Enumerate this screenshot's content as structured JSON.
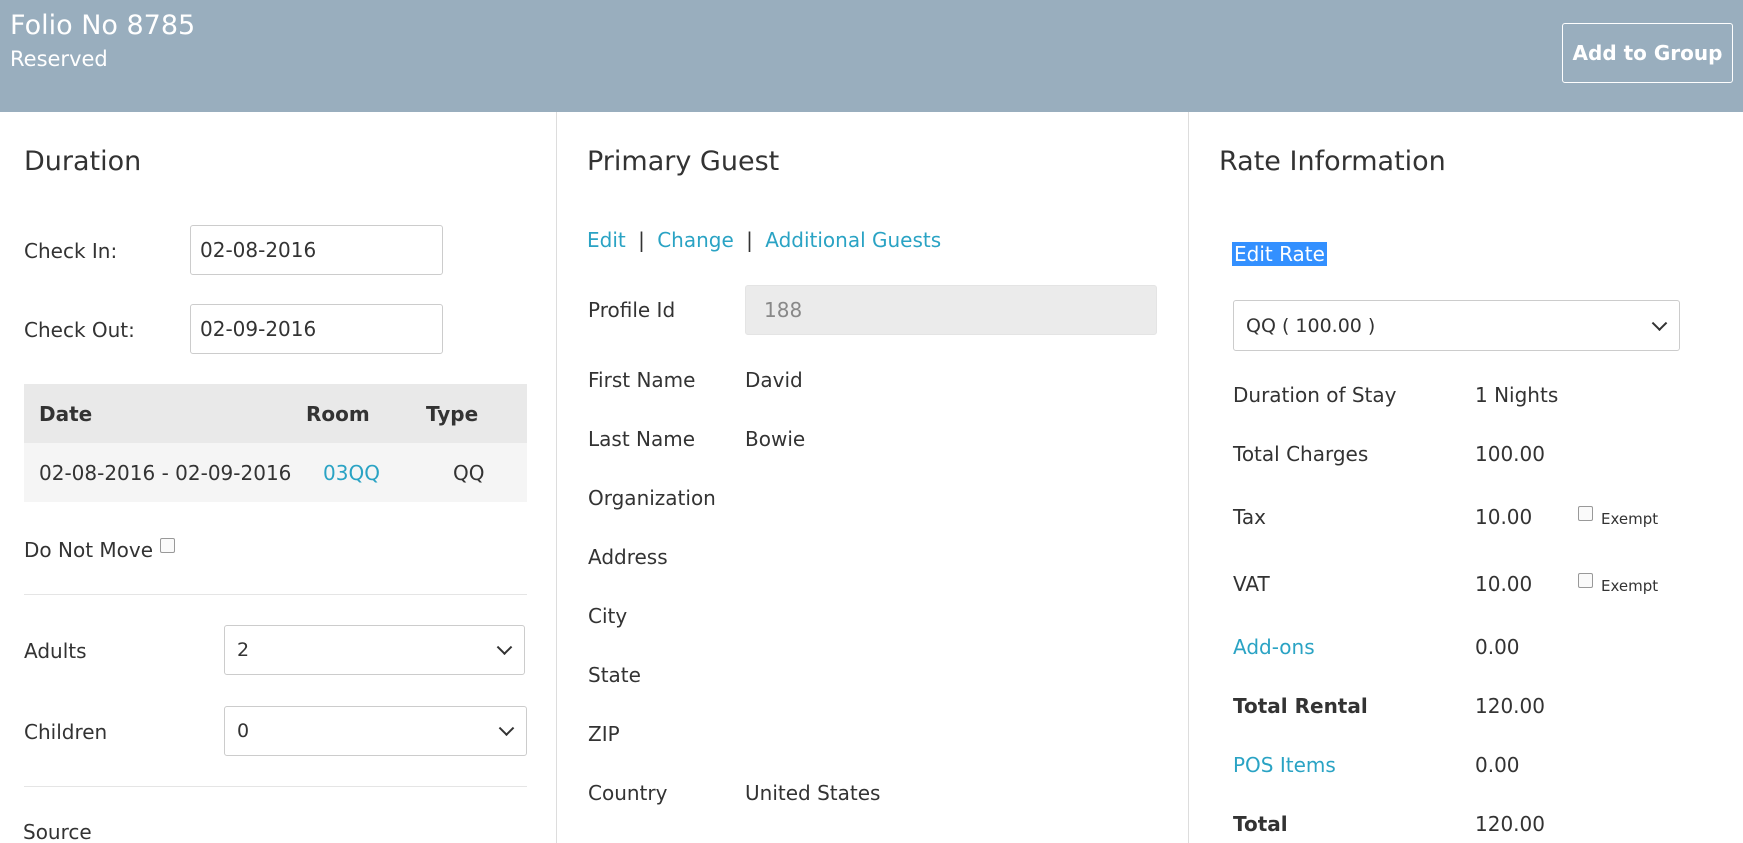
{
  "header": {
    "folio": "Folio No 8785",
    "status": "Reserved",
    "add_to_group": "Add to Group"
  },
  "duration": {
    "title": "Duration",
    "check_in_label": "Check In:",
    "check_in_value": "02-08-2016",
    "check_out_label": "Check Out:",
    "check_out_value": "02-09-2016",
    "table": {
      "headers": [
        "Date",
        "Room",
        "Type"
      ],
      "rows": [
        {
          "date": "02-08-2016 - 02-09-2016",
          "room": "03QQ",
          "type": "QQ"
        }
      ]
    },
    "do_not_move_label": "Do Not Move",
    "adults_label": "Adults",
    "adults_value": "2",
    "children_label": "Children",
    "children_value": "0",
    "source_label": "Source"
  },
  "guest": {
    "title": "Primary Guest",
    "links": {
      "edit": "Edit",
      "sep1": "|",
      "change": "Change",
      "sep2": "|",
      "additional": "Additional Guests"
    },
    "profile_id_label": "Profile Id",
    "profile_id_value": "188",
    "fields": [
      {
        "label": "First Name",
        "value": "David"
      },
      {
        "label": "Last Name",
        "value": "Bowie"
      },
      {
        "label": "Organization",
        "value": ""
      },
      {
        "label": "Address",
        "value": ""
      },
      {
        "label": "City",
        "value": ""
      },
      {
        "label": "State",
        "value": ""
      },
      {
        "label": "ZIP",
        "value": ""
      },
      {
        "label": "Country",
        "value": "United States"
      }
    ]
  },
  "rate": {
    "title": "Rate Information",
    "edit_rate": "Edit Rate",
    "rate_select": "QQ ( 100.00 )",
    "duration_label": "Duration of Stay",
    "duration_value": "1 Nights",
    "total_charges_label": "Total Charges",
    "total_charges_value": "100.00",
    "tax_label": "Tax",
    "tax_value": "10.00",
    "tax_exempt": "Exempt",
    "vat_label": "VAT",
    "vat_value": "10.00",
    "vat_exempt": "Exempt",
    "addons_label": "Add-ons",
    "addons_value": "0.00",
    "total_rental_label": "Total Rental",
    "total_rental_value": "120.00",
    "pos_label": "POS Items",
    "pos_value": "0.00",
    "total_label": "Total",
    "total_value": "120.00"
  }
}
